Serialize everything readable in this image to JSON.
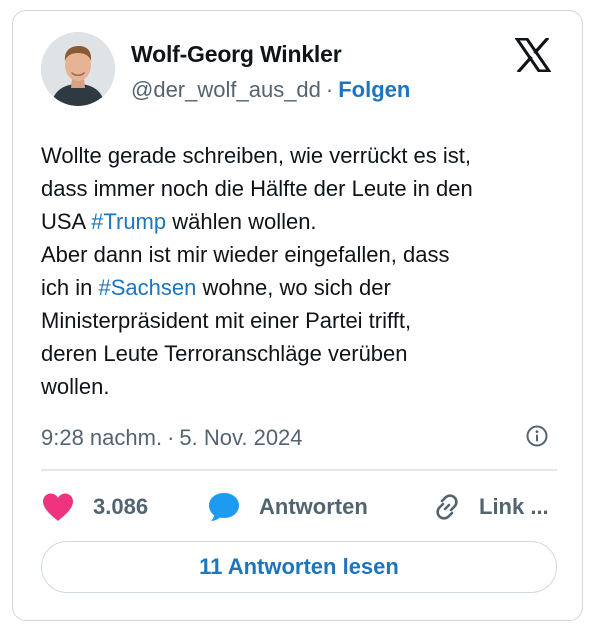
{
  "author": {
    "name": "Wolf-Georg Winkler",
    "handle": "@der_wolf_aus_dd",
    "separator": "·",
    "follow_label": "Folgen",
    "avatar_icon": "person-avatar-photo"
  },
  "platform": {
    "logo_icon": "x-logo-icon"
  },
  "tweet": {
    "lines": [
      {
        "text": "Wollte gerade schreiben, wie verrückt es ist,"
      },
      {
        "text": "dass immer noch die Hälfte der Leute in den"
      },
      {
        "before": "USA ",
        "hashtag": "#Trump",
        "after": " wählen wollen."
      },
      {
        "text": "Aber dann ist mir wieder eingefallen, dass"
      },
      {
        "before": "ich in ",
        "hashtag": "#Sachsen",
        "after": " wohne, wo sich der"
      },
      {
        "text": "Ministerpräsident mit einer Partei trifft,"
      },
      {
        "text": "deren Leute Terroranschläge verüben"
      },
      {
        "text": "wollen."
      }
    ],
    "time": "9:28 nachm.",
    "separator": "·",
    "date": "5. Nov. 2024"
  },
  "actions": {
    "like_count": "3.086",
    "reply_label": "Antworten",
    "link_label": "Link ..."
  },
  "read_replies_label": "11 Antworten lesen",
  "colors": {
    "accent": "#1d75bd",
    "like": "#f0337f",
    "reply": "#1d9bf0",
    "muted": "#536471",
    "border": "#cfd9de"
  }
}
